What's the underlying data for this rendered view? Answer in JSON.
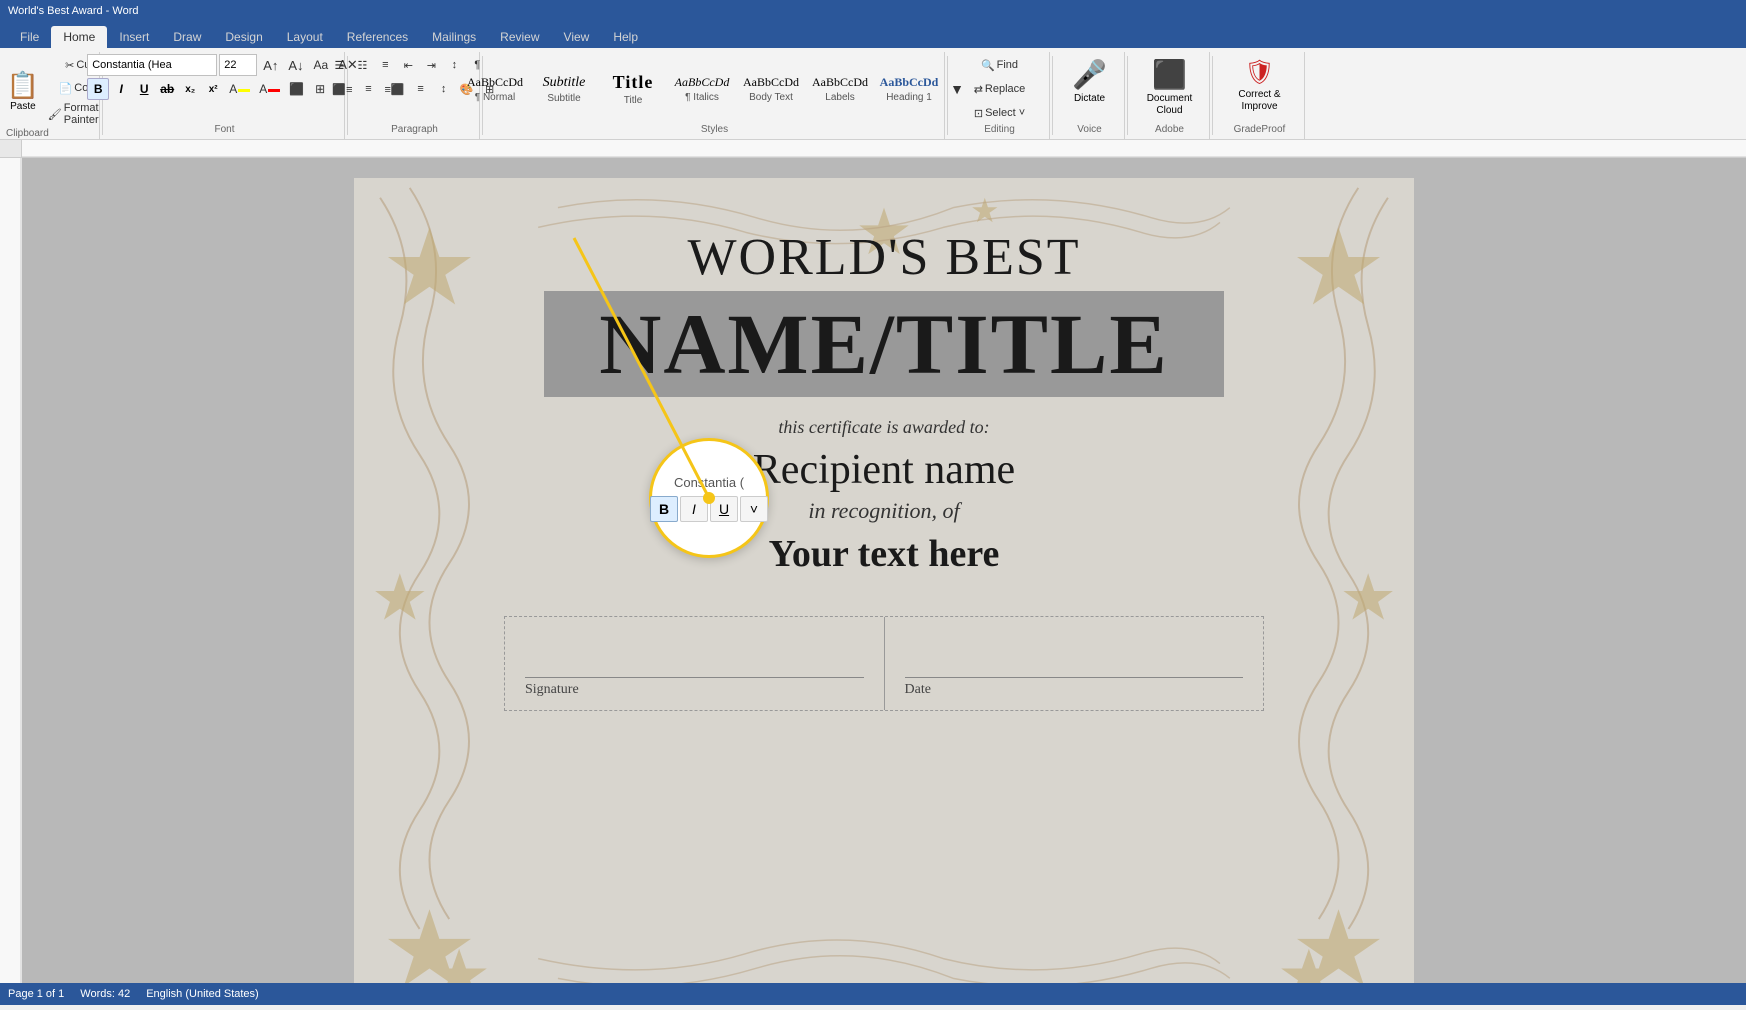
{
  "titlebar": {
    "text": "World's Best Award - Word"
  },
  "ribbon": {
    "tabs": [
      "File",
      "Home",
      "Insert",
      "Draw",
      "Design",
      "Layout",
      "References",
      "Mailings",
      "Review",
      "View",
      "Help"
    ],
    "active_tab": "Home",
    "groups": {
      "clipboard": {
        "label": "Clipboard",
        "paste": "Paste",
        "cut": "Cut",
        "copy": "Copy",
        "format_painter": "Format Painter"
      },
      "font": {
        "label": "Font",
        "font_name": "Constantia (Hea",
        "font_size": "22",
        "bold": "B",
        "italic": "I",
        "underline": "U",
        "strikethrough": "ab",
        "subscript": "x₂",
        "superscript": "x²"
      },
      "paragraph": {
        "label": "Paragraph"
      },
      "styles": {
        "label": "Styles",
        "items": [
          {
            "preview": "AaBbCcDd",
            "label": "¶ Normal",
            "font_size": 11
          },
          {
            "preview": "Subtitle",
            "label": "Subtitle",
            "font_size": 14,
            "italic": true
          },
          {
            "preview": "Title",
            "label": "Title",
            "font_size": 16,
            "bold": true
          },
          {
            "preview": "AaBbCcDd",
            "label": "¶ Italics",
            "font_size": 11,
            "italic": true
          },
          {
            "preview": "AaBbCcDd",
            "label": "Body Text",
            "font_size": 11
          },
          {
            "preview": "AaBbCcDd",
            "label": "Labels",
            "font_size": 11
          },
          {
            "preview": "AaBbCcDd",
            "label": "Heading 1",
            "font_size": 11,
            "bold": true
          }
        ]
      },
      "editing": {
        "label": "Editing",
        "find": "Find",
        "replace": "Replace",
        "select": "Select ˅"
      },
      "voice": {
        "label": "Voice",
        "dictate": "Dictate"
      },
      "adobe": {
        "label": "Adobe",
        "document_cloud": "Document Cloud"
      },
      "gradeproof": {
        "label": "GradeProof",
        "correct_improve": "Correct & Improve"
      }
    }
  },
  "document": {
    "certificate": {
      "title": "WORLD'S BEST",
      "name_title": "NAME/TITLE",
      "awarded_text": "this certificate is awarded to:",
      "recipient": "Recipient name",
      "recognition": "in recognition, of",
      "your_text": "Your text here",
      "signature_label": "Signature",
      "date_label": "Date"
    }
  },
  "mini_toolbar": {
    "font_name": "Constantia (",
    "bold": "B",
    "italic": "I",
    "underline": "U",
    "dropdown": "˅"
  },
  "statusbar": {
    "words": "Words: 42",
    "page": "Page 1 of 1",
    "language": "English (United States)"
  }
}
